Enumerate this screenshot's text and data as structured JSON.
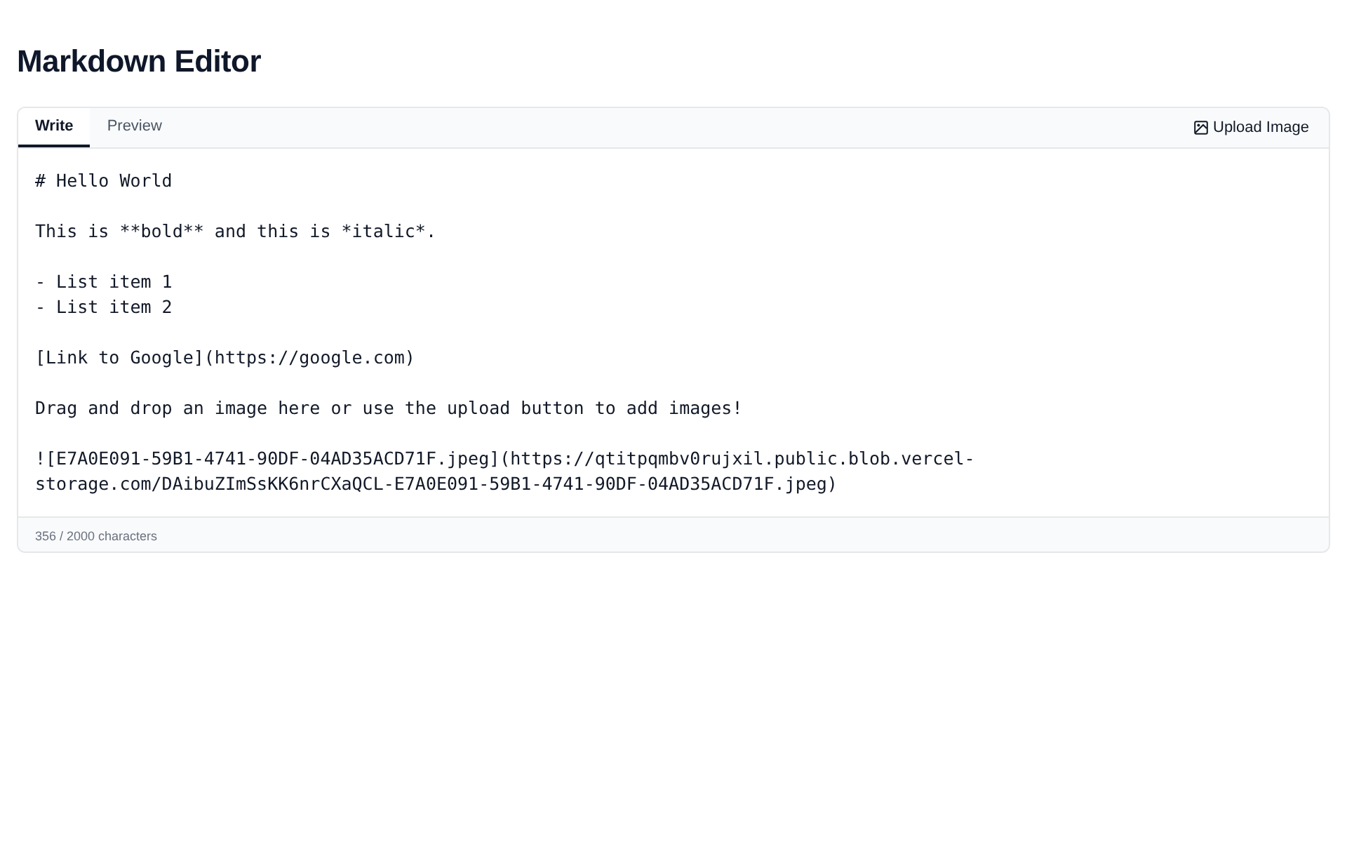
{
  "title": "Markdown Editor",
  "tabs": [
    {
      "label": "Write",
      "selected": true
    },
    {
      "label": "Preview",
      "selected": false
    }
  ],
  "upload_button": "Upload Image",
  "editor_paragraphs": [
    [
      "# Hello World"
    ],
    [
      "This is **bold** and this is *italic*."
    ],
    [
      "- List item 1",
      "- List item 2"
    ],
    [
      "[Link to Google](https://google.com)"
    ],
    [
      "Drag and drop an image here or use the upload button to add images!"
    ],
    [
      "![E7A0E091-59B1-4741-90DF-04AD35ACD71F.jpeg](https://qtitpqmbv0rujxil.public.blob.vercel-",
      "storage.com/DAibuZImSsKK6nrCXaQCL-E7A0E091-59B1-4741-90DF-04AD35ACD71F.jpeg)"
    ]
  ],
  "char_count": "356 / 2000 characters"
}
